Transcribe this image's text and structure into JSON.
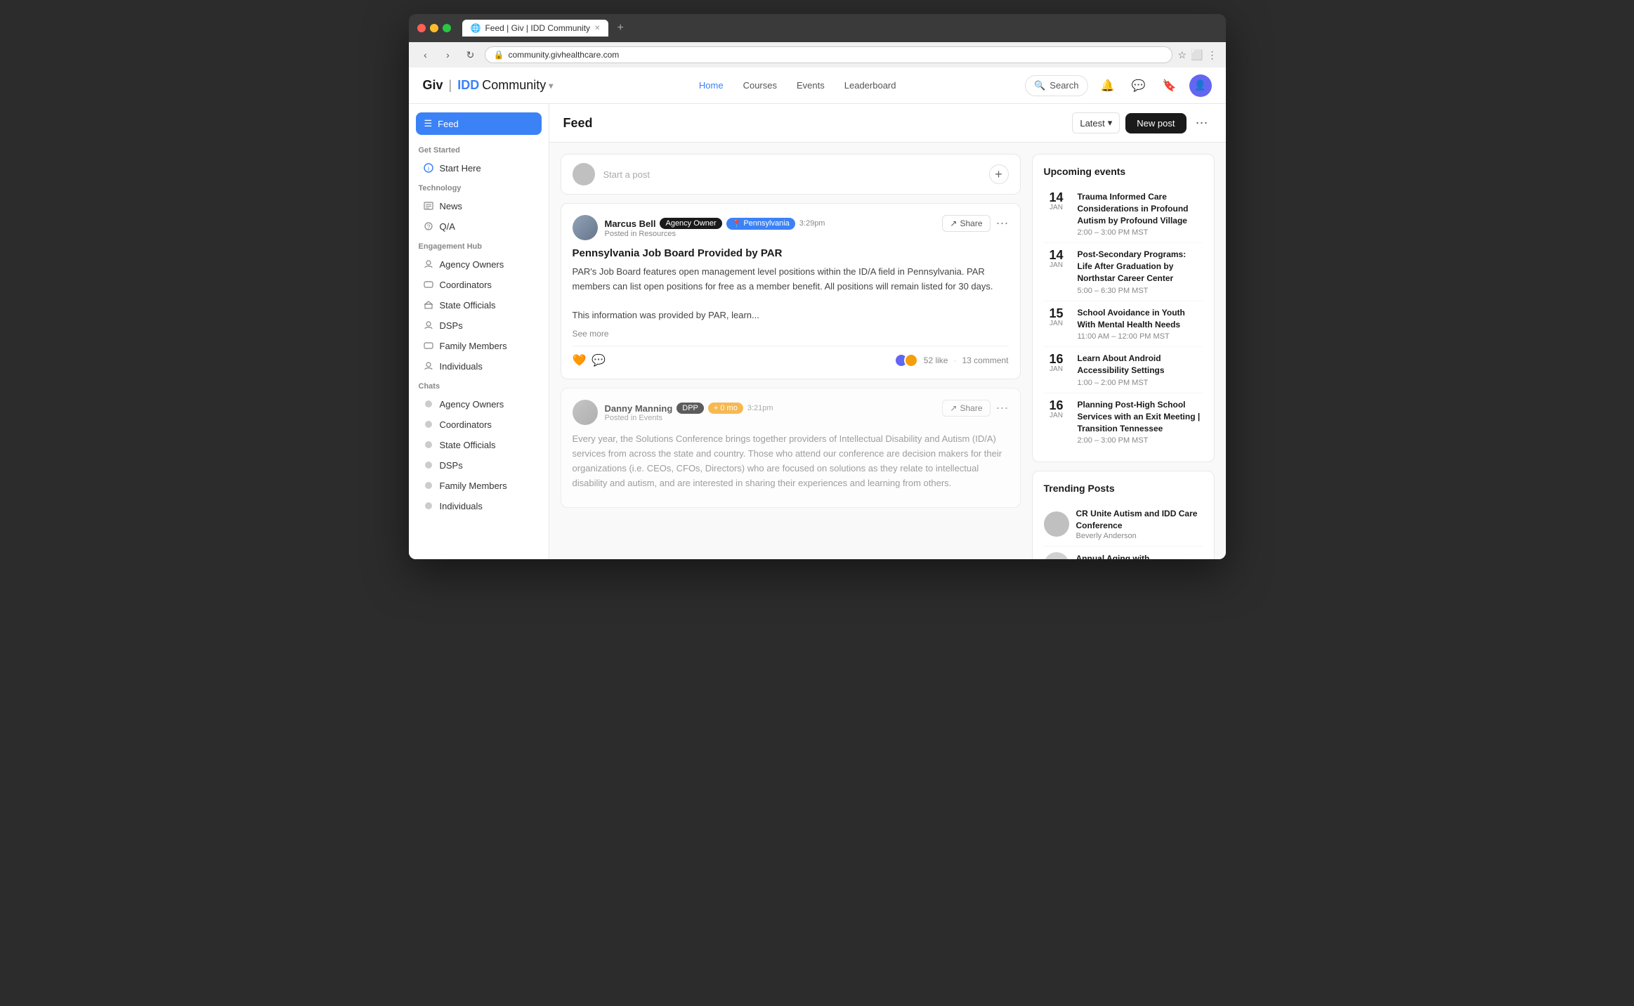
{
  "browser": {
    "tab_title": "Feed | Giv | IDD Community",
    "address": "community.givhealthcare.com",
    "new_tab_label": "+"
  },
  "app": {
    "logo": {
      "giv": "Giv",
      "separator": "|",
      "idd": "IDD",
      "community": "Community",
      "chevron": "▾"
    },
    "nav_links": [
      {
        "label": "Home",
        "active": true
      },
      {
        "label": "Courses",
        "active": false
      },
      {
        "label": "Events",
        "active": false
      },
      {
        "label": "Leaderboard",
        "active": false
      }
    ],
    "search_label": "Search",
    "avatar_initials": "U"
  },
  "sidebar": {
    "feed_label": "Feed",
    "sections": [
      {
        "title": "Get Started",
        "items": [
          {
            "label": "Start Here",
            "icon": "info-icon"
          }
        ]
      },
      {
        "title": "Technology",
        "items": [
          {
            "label": "News",
            "icon": "news-icon"
          },
          {
            "label": "Q/A",
            "icon": "qa-icon"
          }
        ]
      },
      {
        "title": "Engagement Hub",
        "items": [
          {
            "label": "Agency Owners",
            "icon": "person-icon"
          },
          {
            "label": "Coordinators",
            "icon": "chat-icon"
          },
          {
            "label": "State Officials",
            "icon": "building-icon"
          },
          {
            "label": "DSPs",
            "icon": "person-icon"
          },
          {
            "label": "Family Members",
            "icon": "chat-icon"
          },
          {
            "label": "Individuals",
            "icon": "person-icon"
          }
        ]
      },
      {
        "title": "Chats",
        "items": [
          {
            "label": "Agency Owners",
            "icon": "chat-dot-icon"
          },
          {
            "label": "Coordinators",
            "icon": "chat-dot-icon"
          },
          {
            "label": "State Officials",
            "icon": "chat-dot-icon"
          },
          {
            "label": "DSPs",
            "icon": "chat-dot-icon"
          },
          {
            "label": "Family Members",
            "icon": "chat-dot-icon"
          },
          {
            "label": "Individuals",
            "icon": "chat-dot-icon"
          }
        ]
      }
    ]
  },
  "feed": {
    "title": "Feed",
    "latest_label": "Latest",
    "new_post_label": "New post",
    "composer_placeholder": "Start a post",
    "posts": [
      {
        "author": "Marcus Bell",
        "badge_owner": "Agency Owner",
        "badge_state": "Pennsylvania",
        "time": "3:29pm",
        "posted_in": "Posted in Resources",
        "title": "Pennsylvania Job Board Provided by PAR",
        "body": "PAR's Job Board features open management level positions within the ID/A field in Pennsylvania. PAR members can list open positions for free as a member benefit. All positions will remain listed for 30 days.\n\nThis information was provided by PAR, learn...",
        "see_more": "See more",
        "share_label": "Share",
        "likes": "52 like",
        "comments": "13 comment"
      },
      {
        "author": "Danny Manning",
        "badge_owner": "DPP",
        "badge_extra": "+ 0 mo",
        "time": "3:21pm",
        "posted_in": "Posted in Events",
        "title": "",
        "body": "Every year, the Solutions Conference brings together providers of Intellectual Disability and Autism (ID/A) services from across the state and country. Those who attend our conference are decision makers for their organizations (i.e. CEOs, CFOs, Directors) who are focused on solutions as they relate to intellectual disability and autism, and are interested in sharing their experiences and learning from others.",
        "share_label": "Share"
      }
    ]
  },
  "upcoming_events": {
    "title": "Upcoming events",
    "events": [
      {
        "date_num": "14",
        "date_month": "JAN",
        "title": "Trauma Informed Care Considerations in Profound Autism by Profound Village",
        "time": "2:00 – 3:00 PM MST"
      },
      {
        "date_num": "14",
        "date_month": "JAN",
        "title": "Post-Secondary Programs: Life After Graduation by Northstar Career Center",
        "time": "5:00 – 6:30 PM MST"
      },
      {
        "date_num": "15",
        "date_month": "JAN",
        "title": "School Avoidance in Youth With Mental Health Needs",
        "time": "11:00 AM – 12:00 PM MST"
      },
      {
        "date_num": "16",
        "date_month": "JAN",
        "title": "Learn About Android Accessibility Settings",
        "time": "1:00 – 2:00 PM MST"
      },
      {
        "date_num": "16",
        "date_month": "JAN",
        "title": "Planning Post-High School Services with an Exit Meeting | Transition Tennessee",
        "time": "2:00 – 3:00 PM MST"
      }
    ]
  },
  "trending_posts": {
    "title": "Trending Posts",
    "posts": [
      {
        "title": "CR Unite Autism and IDD Care Conference",
        "author": "Beverly Anderson"
      },
      {
        "title": "Annual Aging with Developmental Disabilities",
        "author": ""
      }
    ]
  }
}
